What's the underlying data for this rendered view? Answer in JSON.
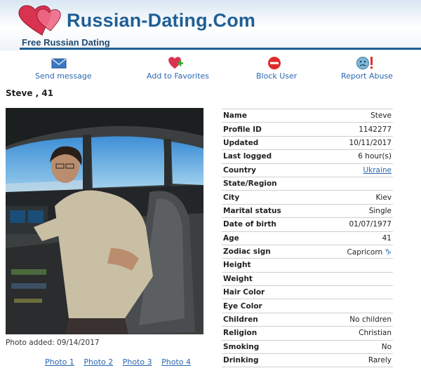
{
  "site": {
    "title": "Russian-Dating.Com",
    "subtitle": "Free Russian Dating"
  },
  "actions": [
    {
      "label": "Send message",
      "icon": "envelope-icon"
    },
    {
      "label": "Add to Favorites",
      "icon": "heart-plus-icon"
    },
    {
      "label": "Block User",
      "icon": "block-icon"
    },
    {
      "label": "Report Abuse",
      "icon": "report-icon"
    }
  ],
  "profile": {
    "heading": "Steve , 41"
  },
  "photo": {
    "caption": "Photo added: 09/14/2017",
    "links": [
      "Photo 1",
      "Photo 2",
      "Photo 3",
      "Photo 4"
    ]
  },
  "details": [
    {
      "label": "Name",
      "value": "Steve"
    },
    {
      "label": "Profile ID",
      "value": "1142277"
    },
    {
      "label": "Updated",
      "value": "10/11/2017"
    },
    {
      "label": "Last logged",
      "value": "6 hour(s)"
    },
    {
      "label": "Country",
      "value": "Ukraine"
    },
    {
      "label": "State/Region",
      "value": ""
    },
    {
      "label": "City",
      "value": "Kiev"
    },
    {
      "label": "Marital status",
      "value": "Single"
    },
    {
      "label": "Date of birth",
      "value": "01/07/1977"
    },
    {
      "label": "Age",
      "value": "41"
    },
    {
      "label": "Zodiac sign",
      "value": "Capricorn"
    },
    {
      "label": "Height",
      "value": ""
    },
    {
      "label": "Weight",
      "value": ""
    },
    {
      "label": "Hair Color",
      "value": ""
    },
    {
      "label": "Eye Color",
      "value": ""
    },
    {
      "label": "Children",
      "value": "No children"
    },
    {
      "label": "Religion",
      "value": "Christian"
    },
    {
      "label": "Smoking",
      "value": "No"
    },
    {
      "label": "Drinking",
      "value": "Rarely"
    }
  ],
  "colors": {
    "brand": "#1f5f96",
    "link": "#2a68b0",
    "heart": "#d9334f"
  }
}
